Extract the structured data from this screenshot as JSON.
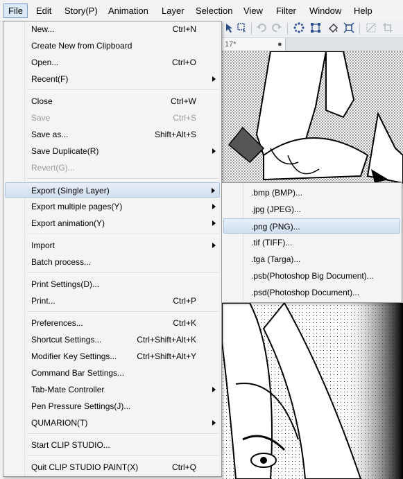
{
  "menubar": {
    "items": [
      "File",
      "Edit",
      "Story(P)",
      "Animation",
      "Layer",
      "Selection",
      "View",
      "Filter",
      "Window",
      "Help"
    ]
  },
  "document_tab": {
    "title": "17*",
    "close_glyph": "●"
  },
  "toolbar_icons": [
    "select-arrow-icon",
    "lasso-select-icon",
    "undo-icon",
    "redo-icon",
    "loading-icon",
    "transform-icon",
    "fill-icon",
    "fit-icon",
    "clear-icon",
    "crop-icon"
  ],
  "file_menu": {
    "items": [
      {
        "label": "New...",
        "shortcut": "Ctrl+N"
      },
      {
        "label": "Create New from Clipboard",
        "shortcut": ""
      },
      {
        "label": "Open...",
        "shortcut": "Ctrl+O"
      },
      {
        "label": "Recent(F)",
        "shortcut": "",
        "submenu": true
      },
      {
        "label": "Close",
        "shortcut": "Ctrl+W"
      },
      {
        "label": "Save",
        "shortcut": "Ctrl+S",
        "disabled": true
      },
      {
        "label": "Save as...",
        "shortcut": "Shift+Alt+S"
      },
      {
        "label": "Save Duplicate(R)",
        "shortcut": "",
        "submenu": true
      },
      {
        "label": "Revert(G)...",
        "shortcut": "",
        "disabled": true
      },
      {
        "label": "Export (Single Layer)",
        "shortcut": "",
        "submenu": true,
        "highlighted": true
      },
      {
        "label": "Export multiple pages(Y)",
        "shortcut": "",
        "submenu": true
      },
      {
        "label": "Export animation(Y)",
        "shortcut": "",
        "submenu": true
      },
      {
        "label": "Import",
        "shortcut": "",
        "submenu": true
      },
      {
        "label": "Batch process...",
        "shortcut": ""
      },
      {
        "label": "Print Settings(D)...",
        "shortcut": ""
      },
      {
        "label": "Print...",
        "shortcut": "Ctrl+P"
      },
      {
        "label": "Preferences...",
        "shortcut": "Ctrl+K"
      },
      {
        "label": "Shortcut Settings...",
        "shortcut": "Ctrl+Shift+Alt+K"
      },
      {
        "label": "Modifier Key Settings...",
        "shortcut": "Ctrl+Shift+Alt+Y"
      },
      {
        "label": "Command Bar Settings...",
        "shortcut": ""
      },
      {
        "label": "Tab-Mate Controller",
        "shortcut": "",
        "submenu": true
      },
      {
        "label": "Pen Pressure Settings(J)...",
        "shortcut": ""
      },
      {
        "label": "QUMARION(T)",
        "shortcut": "",
        "submenu": true
      },
      {
        "label": "Start CLIP STUDIO...",
        "shortcut": ""
      },
      {
        "label": "Quit CLIP STUDIO PAINT(X)",
        "shortcut": "Ctrl+Q"
      }
    ]
  },
  "export_submenu": {
    "items": [
      {
        "label": ".bmp (BMP)..."
      },
      {
        "label": ".jpg (JPEG)..."
      },
      {
        "label": ".png (PNG)...",
        "highlighted": true
      },
      {
        "label": ".tif (TIFF)..."
      },
      {
        "label": ".tga (Targa)..."
      },
      {
        "label": ".psb(Photoshop Big Document)..."
      },
      {
        "label": ".psd(Photoshop Document)..."
      }
    ]
  }
}
